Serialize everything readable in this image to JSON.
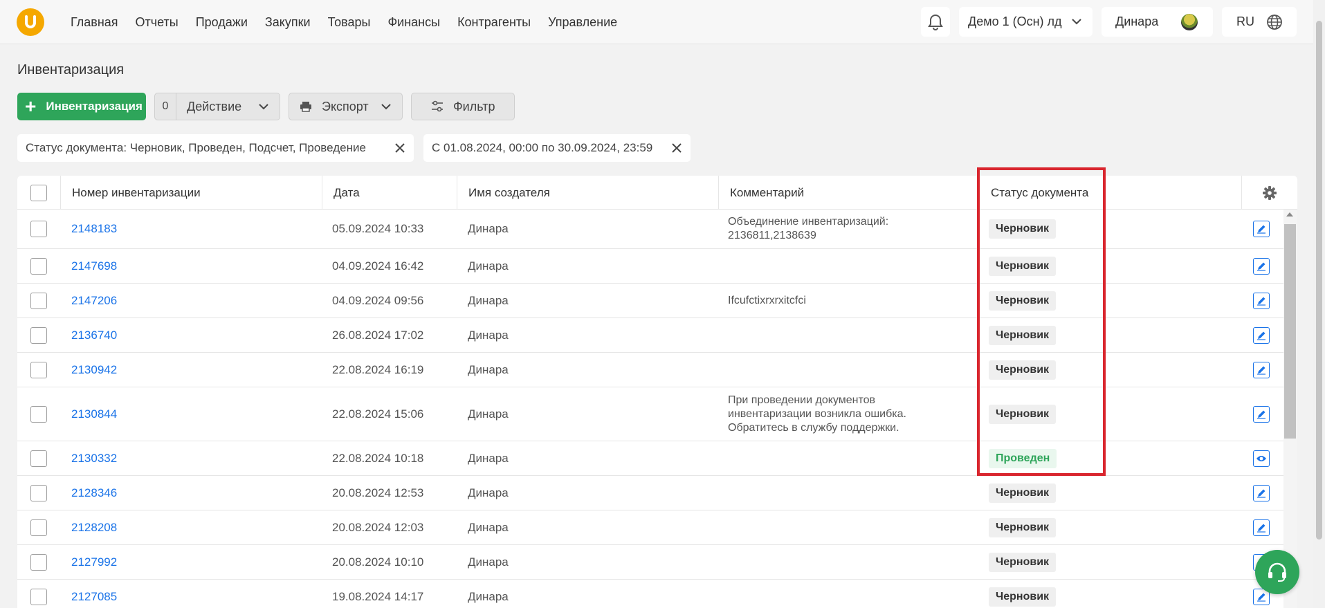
{
  "nav": {
    "items": [
      "Главная",
      "Отчеты",
      "Продажи",
      "Закупки",
      "Товары",
      "Финансы",
      "Контрагенты",
      "Управление"
    ],
    "store_select": "Демо 1 (Осн) лд",
    "user_name": "Динара",
    "language": "RU"
  },
  "page": {
    "title": "Инвентаризация"
  },
  "toolbar": {
    "add_label": "Инвентаризация",
    "selected_count": "0",
    "action_label": "Действие",
    "export_label": "Экспорт",
    "filter_label": "Фильтр"
  },
  "filters": {
    "status_chip": "Статус документа: Черновик, Проведен, Подсчет, Проведение",
    "date_chip": "С 01.08.2024, 00:00 по 30.09.2024, 23:59"
  },
  "table": {
    "columns": {
      "number": "Номер инвентаризации",
      "date": "Дата",
      "creator": "Имя создателя",
      "comment": "Комментарий",
      "status": "Статус документа"
    },
    "rows": [
      {
        "number": "2148183",
        "date": "05.09.2024 10:33",
        "creator": "Динара",
        "comment": "Объединение инвентаризаций: 2136811,2138639",
        "status": "Черновик",
        "action": "edit"
      },
      {
        "number": "2147698",
        "date": "04.09.2024 16:42",
        "creator": "Динара",
        "comment": "",
        "status": "Черновик",
        "action": "edit"
      },
      {
        "number": "2147206",
        "date": "04.09.2024 09:56",
        "creator": "Динара",
        "comment": "Ifcufctixrxrxitcfci",
        "status": "Черновик",
        "action": "edit"
      },
      {
        "number": "2136740",
        "date": "26.08.2024 17:02",
        "creator": "Динара",
        "comment": "",
        "status": "Черновик",
        "action": "edit"
      },
      {
        "number": "2130942",
        "date": "22.08.2024 16:19",
        "creator": "Динара",
        "comment": "",
        "status": "Черновик",
        "action": "edit"
      },
      {
        "number": "2130844",
        "date": "22.08.2024 15:06",
        "creator": "Динара",
        "comment": "При проведении документов инвентаризации возникла ошибка. Обратитесь в службу поддержки.",
        "status": "Черновик",
        "action": "edit"
      },
      {
        "number": "2130332",
        "date": "22.08.2024 10:18",
        "creator": "Динара",
        "comment": "",
        "status": "Проведен",
        "action": "view"
      },
      {
        "number": "2128346",
        "date": "20.08.2024 12:53",
        "creator": "Динара",
        "comment": "",
        "status": "Черновик",
        "action": "edit"
      },
      {
        "number": "2128208",
        "date": "20.08.2024 12:03",
        "creator": "Динара",
        "comment": "",
        "status": "Черновик",
        "action": "edit"
      },
      {
        "number": "2127992",
        "date": "20.08.2024 10:10",
        "creator": "Динара",
        "comment": "",
        "status": "Черновик",
        "action": "edit"
      },
      {
        "number": "2127085",
        "date": "19.08.2024 14:17",
        "creator": "Динара",
        "comment": "",
        "status": "Черновик",
        "action": "edit"
      }
    ]
  },
  "colors": {
    "primary_green": "#2ea55a",
    "link_blue": "#1a73e8",
    "logo_orange": "#f5a800",
    "highlight_red": "#d9262e"
  }
}
